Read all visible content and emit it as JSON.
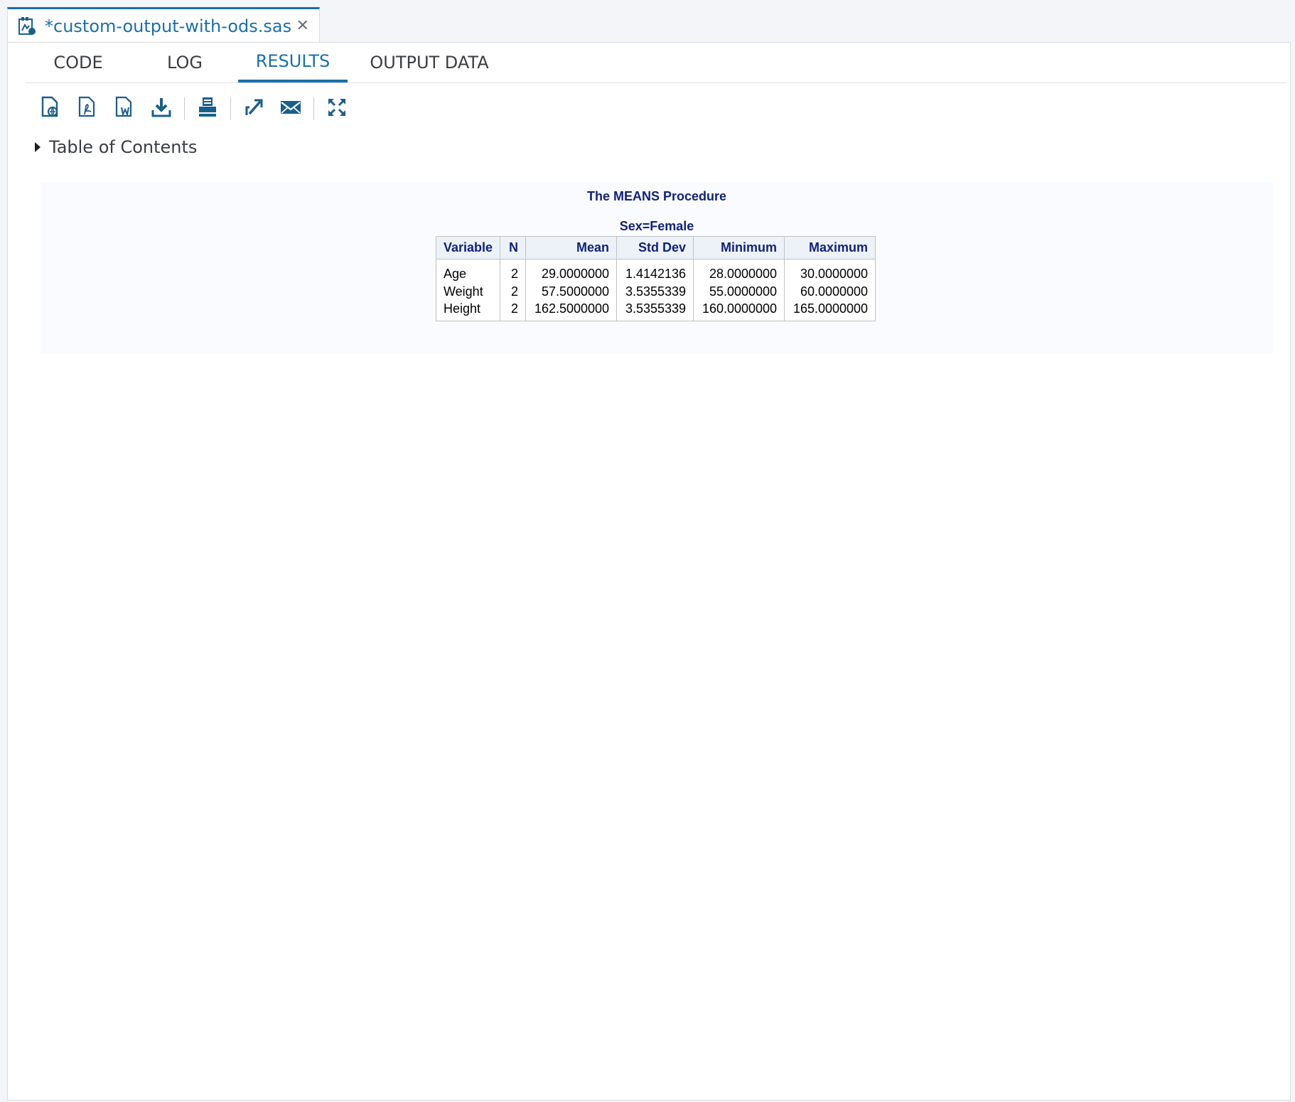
{
  "file_tab": {
    "name": "*custom-output-with-ods.sas",
    "icon": "sas-program-file-icon",
    "close_label": "✕"
  },
  "view_tabs": [
    {
      "label": "CODE",
      "active": false
    },
    {
      "label": "LOG",
      "active": false
    },
    {
      "label": "RESULTS",
      "active": true
    },
    {
      "label": "OUTPUT DATA",
      "active": false
    }
  ],
  "toolbar": {
    "icons": [
      "download-html-icon",
      "download-pdf-icon",
      "download-word-icon",
      "download-icon",
      "print-icon",
      "open-in-new-tab-icon",
      "email-icon",
      "maximize-icon"
    ]
  },
  "toc": {
    "label": "Table of Contents"
  },
  "output": {
    "title": "The MEANS Procedure",
    "by_group": "Sex=Female",
    "columns": [
      "Variable",
      "N",
      "Mean",
      "Std Dev",
      "Minimum",
      "Maximum"
    ],
    "rows": [
      [
        "Age",
        "2",
        "29.0000000",
        "1.4142136",
        "28.0000000",
        "30.0000000"
      ],
      [
        "Weight",
        "2",
        "57.5000000",
        "3.5355339",
        "55.0000000",
        "60.0000000"
      ],
      [
        "Height",
        "2",
        "162.5000000",
        "3.5355339",
        "160.0000000",
        "165.0000000"
      ]
    ]
  },
  "colors": {
    "accent": "#1b6fa8",
    "icon": "#1c5e8a",
    "table_header_text": "#112277"
  }
}
